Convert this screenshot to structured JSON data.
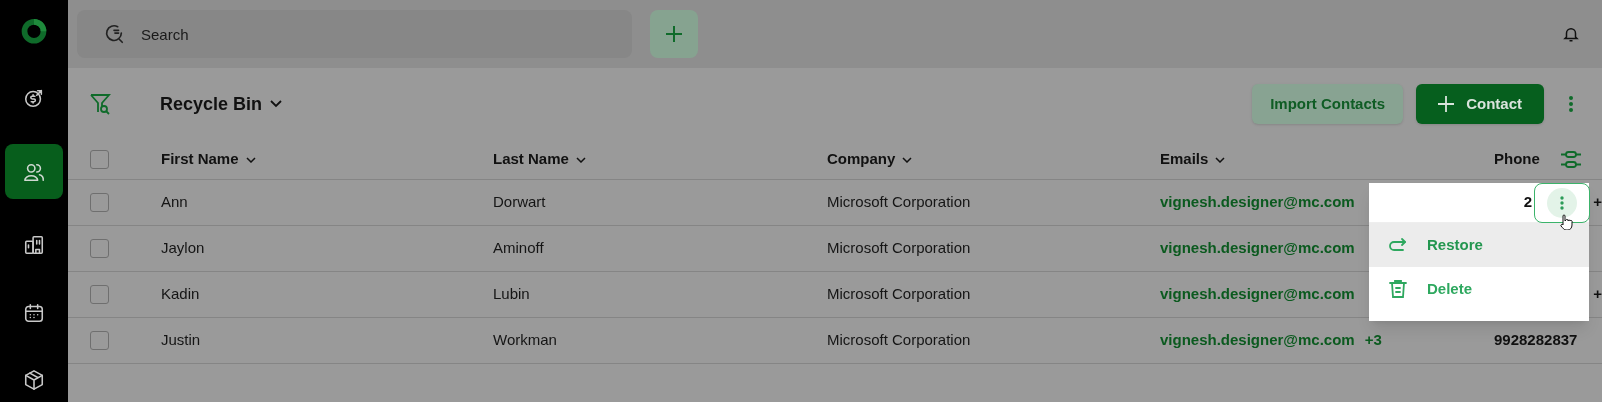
{
  "sidebar": {
    "items": [
      {
        "selected": false
      },
      {
        "selected": true
      },
      {
        "selected": false
      },
      {
        "selected": false
      },
      {
        "selected": false
      }
    ]
  },
  "search": {
    "placeholder": "Search"
  },
  "view": {
    "title": "Recycle Bin"
  },
  "actions": {
    "import": "Import Contacts",
    "add": "Contact"
  },
  "table": {
    "all_checked": false,
    "columns": [
      "First Name",
      "Last Name",
      "Company",
      "Emails",
      "Phone"
    ],
    "rows": [
      {
        "checked": false,
        "first": "Ann",
        "last": "Dorwart",
        "company": "Microsoft Corporation",
        "email": "vignesh.designer@mc.com",
        "email_extra": "",
        "phone": "",
        "phone_extra": "+"
      },
      {
        "checked": false,
        "first": "Jaylon",
        "last": "Aminoff",
        "company": "Microsoft Corporation",
        "email": "vignesh.designer@mc.com",
        "email_extra": "",
        "phone": "",
        "phone_extra": ""
      },
      {
        "checked": false,
        "first": "Kadin",
        "last": "Lubin",
        "company": "Microsoft Corporation",
        "email": "vignesh.designer@mc.com",
        "email_extra": "",
        "phone": "",
        "phone_extra": "+"
      },
      {
        "checked": false,
        "first": "Justin",
        "last": "Workman",
        "company": "Microsoft Corporation",
        "email": "vignesh.designer@mc.com",
        "email_extra": "+3",
        "phone": "9928282837",
        "phone_extra": ""
      }
    ]
  },
  "row_menu": {
    "row_peek": "2",
    "items": [
      {
        "label": "Restore",
        "selected": true
      },
      {
        "label": "Delete",
        "selected": false
      }
    ]
  }
}
